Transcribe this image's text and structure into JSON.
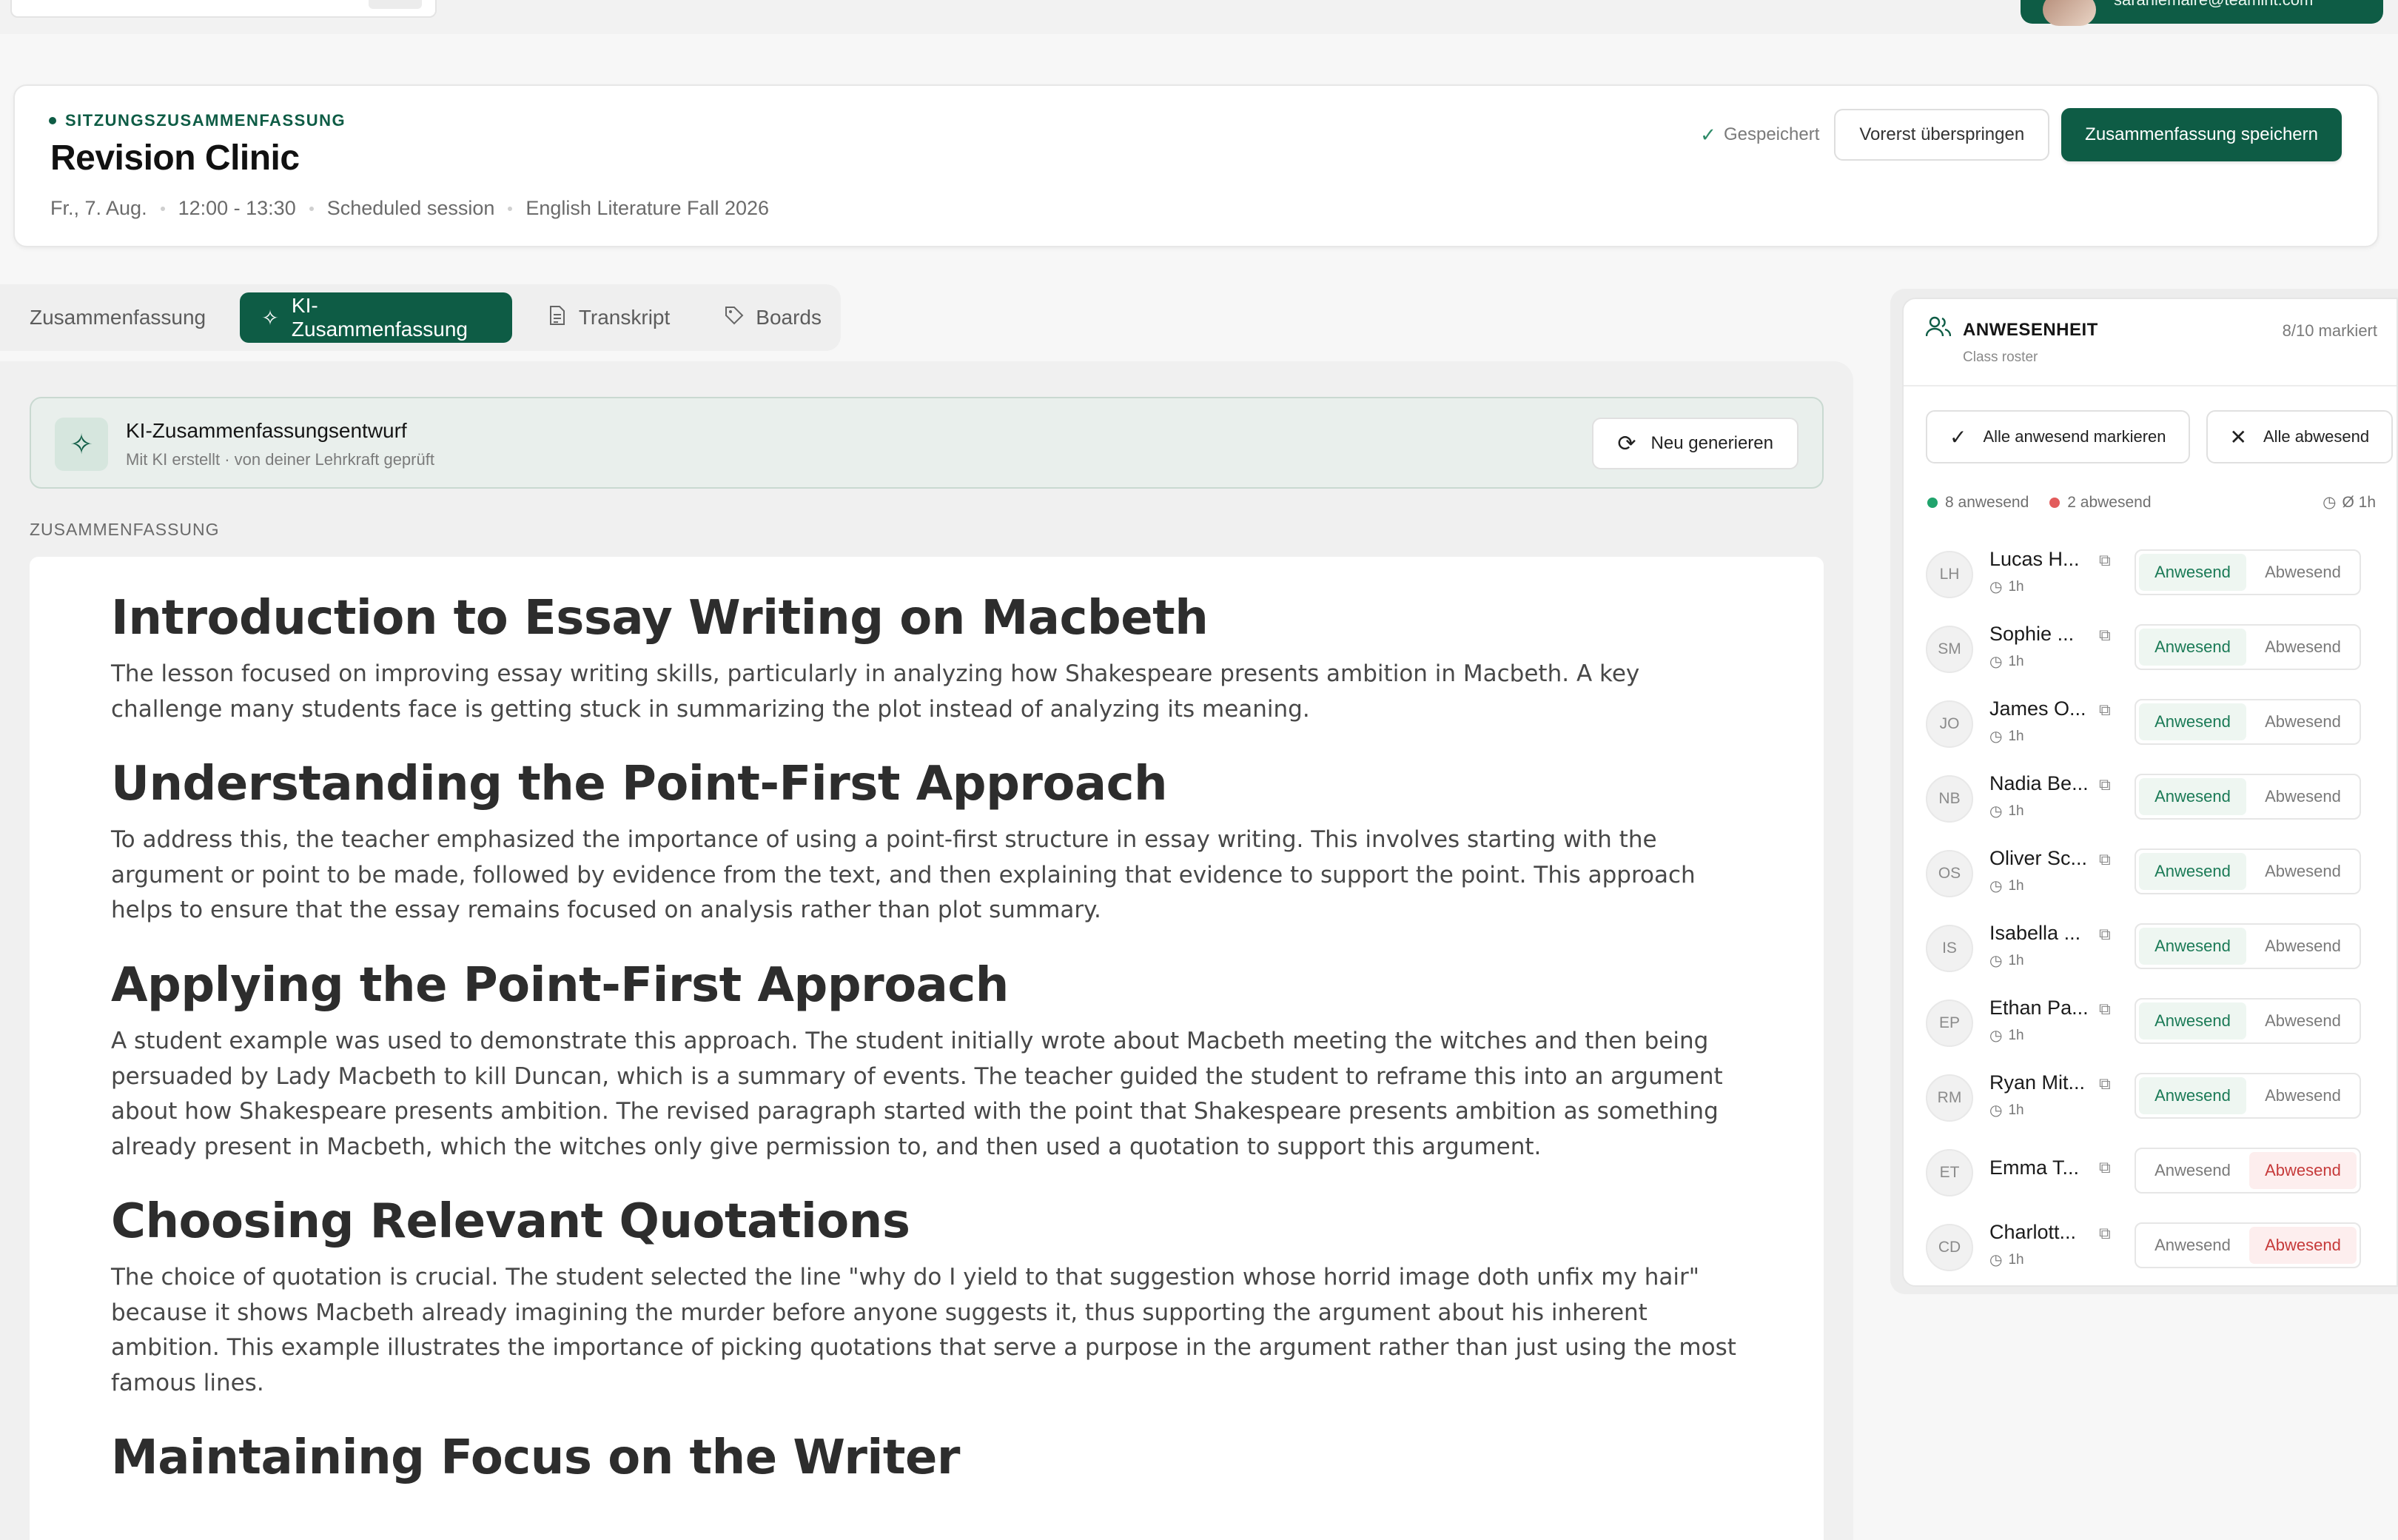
{
  "topbar": {
    "user_email": "sarahlemaire@teamint.com"
  },
  "session": {
    "eyebrow": "SITZUNGSZUSAMMENFASSUNG",
    "title": "Revision Clinic",
    "date": "Fr., 7. Aug.",
    "time": "12:00 - 13:30",
    "type": "Scheduled session",
    "course": "English Literature Fall 2026",
    "saved_label": "Gespeichert",
    "skip_label": "Vorerst überspringen",
    "save_label": "Zusammenfassung speichern"
  },
  "tabs": [
    {
      "label": "Zusammenfassung",
      "icon": "",
      "active": false
    },
    {
      "label": "KI-Zusammenfassung",
      "icon": "sparkle-icon",
      "active": true
    },
    {
      "label": "Transkript",
      "icon": "document-icon",
      "active": false
    },
    {
      "label": "Boards",
      "icon": "tag-icon",
      "active": false
    }
  ],
  "draft": {
    "title": "KI-Zusammenfassungsentwurf",
    "subtitle": "Mit KI erstellt · von deiner Lehrkraft geprüft",
    "regenerate_label": "Neu generieren"
  },
  "summary": {
    "section_label": "ZUSAMMENFASSUNG",
    "blocks": [
      {
        "heading": "Introduction to Essay Writing on Macbeth",
        "body": "The lesson focused on improving essay writing skills, particularly in analyzing how Shakespeare presents ambition in Macbeth. A key challenge many students face is getting stuck in summarizing the plot instead of analyzing its meaning."
      },
      {
        "heading": "Understanding the Point-First Approach",
        "body": "To address this, the teacher emphasized the importance of using a point-first structure in essay writing. This involves starting with the argument or point to be made, followed by evidence from the text, and then explaining that evidence to support the point. This approach helps to ensure that the essay remains focused on analysis rather than plot summary."
      },
      {
        "heading": "Applying the Point-First Approach",
        "body": "A student example was used to demonstrate this approach. The student initially wrote about Macbeth meeting the witches and then being persuaded by Lady Macbeth to kill Duncan, which is a summary of events. The teacher guided the student to reframe this into an argument about how Shakespeare presents ambition. The revised paragraph started with the point that Shakespeare presents ambition as something already present in Macbeth, which the witches only give permission to, and then used a quotation to support this argument."
      },
      {
        "heading": "Choosing Relevant Quotations",
        "body": "The choice of quotation is crucial. The student selected the line \"why do I yield to that suggestion whose horrid image doth unfix my hair\" because it shows Macbeth already imagining the murder before anyone suggests it, thus supporting the argument about his inherent ambition. This example illustrates the importance of picking quotations that serve a purpose in the argument rather than just using the most famous lines."
      },
      {
        "heading": "Maintaining Focus on the Writer",
        "body": ""
      }
    ]
  },
  "attendance": {
    "title": "ANWESENHEIT",
    "subtitle": "Class roster",
    "marked": "8/10 markiert",
    "mark_all_present": "Alle anwesend markieren",
    "mark_all_absent": "Alle abwesend",
    "present_count": "8 anwesend",
    "absent_count": "2 abwesend",
    "avg": "Ø 1h",
    "present_label": "Anwesend",
    "absent_label": "Abwesend",
    "students": [
      {
        "initials": "LH",
        "name": "Lucas H...",
        "duration": "1h",
        "status": "present"
      },
      {
        "initials": "SM",
        "name": "Sophie ...",
        "duration": "1h",
        "status": "present"
      },
      {
        "initials": "JO",
        "name": "James O...",
        "duration": "1h",
        "status": "present"
      },
      {
        "initials": "NB",
        "name": "Nadia Be...",
        "duration": "1h",
        "status": "present"
      },
      {
        "initials": "OS",
        "name": "Oliver Sc...",
        "duration": "1h",
        "status": "present"
      },
      {
        "initials": "IS",
        "name": "Isabella ...",
        "duration": "1h",
        "status": "present"
      },
      {
        "initials": "EP",
        "name": "Ethan Pa...",
        "duration": "1h",
        "status": "present"
      },
      {
        "initials": "RM",
        "name": "Ryan Mit...",
        "duration": "1h",
        "status": "present"
      },
      {
        "initials": "ET",
        "name": "Emma T...",
        "duration": "",
        "status": "absent"
      },
      {
        "initials": "CD",
        "name": "Charlott...",
        "duration": "1h",
        "status": "absent"
      }
    ]
  },
  "colors": {
    "brand": "#0e5c45",
    "present": "#1a7a56",
    "absent": "#c63a3a"
  }
}
